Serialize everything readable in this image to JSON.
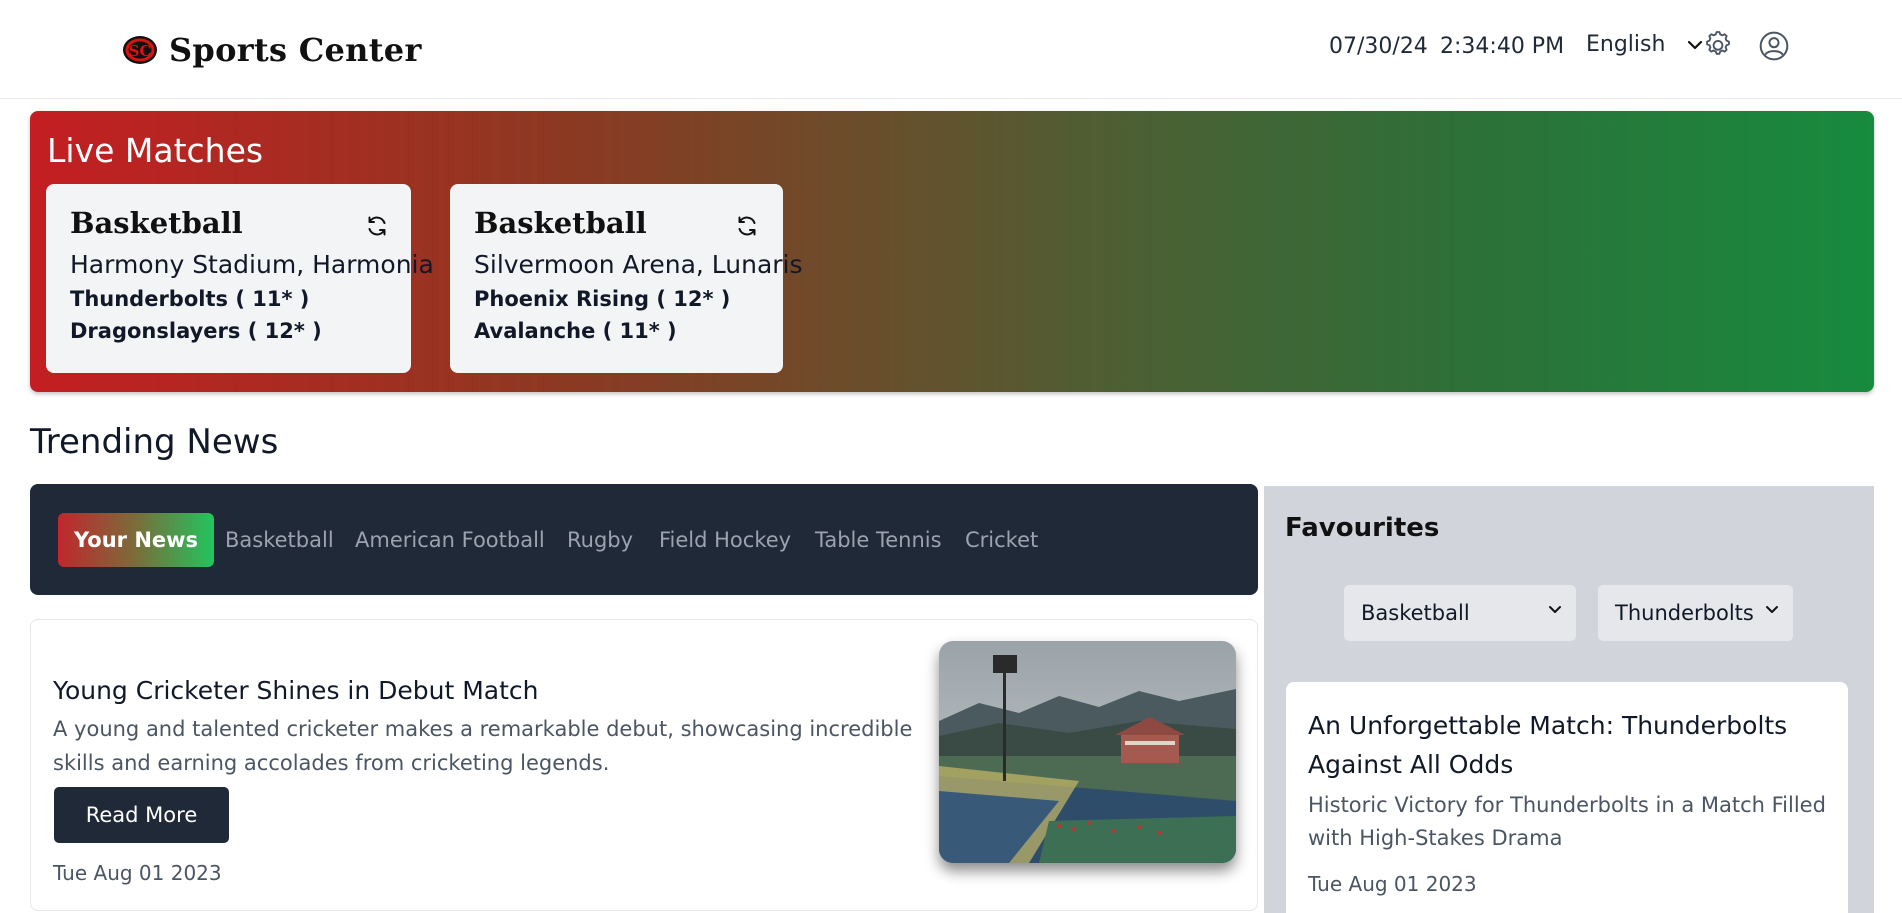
{
  "header": {
    "brand": "Sports Center",
    "logo_text": "SC",
    "date": "07/30/24",
    "time": "2:34:40 PM",
    "language": "English"
  },
  "live": {
    "title": "Live Matches",
    "matches": [
      {
        "sport": "Basketball",
        "venue": "Harmony Stadium, Harmonia",
        "team1": "Thunderbolts ( 11* )",
        "team2": "Dragonslayers ( 12* )"
      },
      {
        "sport": "Basketball",
        "venue": "Silvermoon Arena, Lunaris",
        "team1": "Phoenix Rising ( 12* )",
        "team2": "Avalanche ( 11* )"
      }
    ]
  },
  "trending": {
    "title": "Trending News",
    "tabs": [
      "Your News",
      "Basketball",
      "American Football",
      "Rugby",
      "Field Hockey",
      "Table Tennis",
      "Cricket"
    ],
    "article": {
      "title": "Young Cricketer Shines in Debut Match",
      "description": "A young and talented cricketer makes a remarkable debut, showcasing incredible skills and earning accolades from cricketing legends.",
      "button": "Read More",
      "date": "Tue Aug 01 2023"
    }
  },
  "favourites": {
    "title": "Favourites",
    "sport_selected": "Basketball",
    "team_selected": "Thunderbolts",
    "article": {
      "title": "An Unforgettable Match: Thunderbolts Against All Odds",
      "description": "Historic Victory for Thunderbolts in a Match Filled with High-Stakes Drama",
      "date": "Tue Aug 01 2023"
    }
  },
  "colors": {
    "live_gradient_start": "#c41e22",
    "live_gradient_end": "#178b3e",
    "dark_navy": "#1f2937"
  },
  "icons": {
    "settings": "gear-icon",
    "profile": "user-circle-icon",
    "refresh": "refresh-icon",
    "dropdown": "chevron-down-icon"
  }
}
